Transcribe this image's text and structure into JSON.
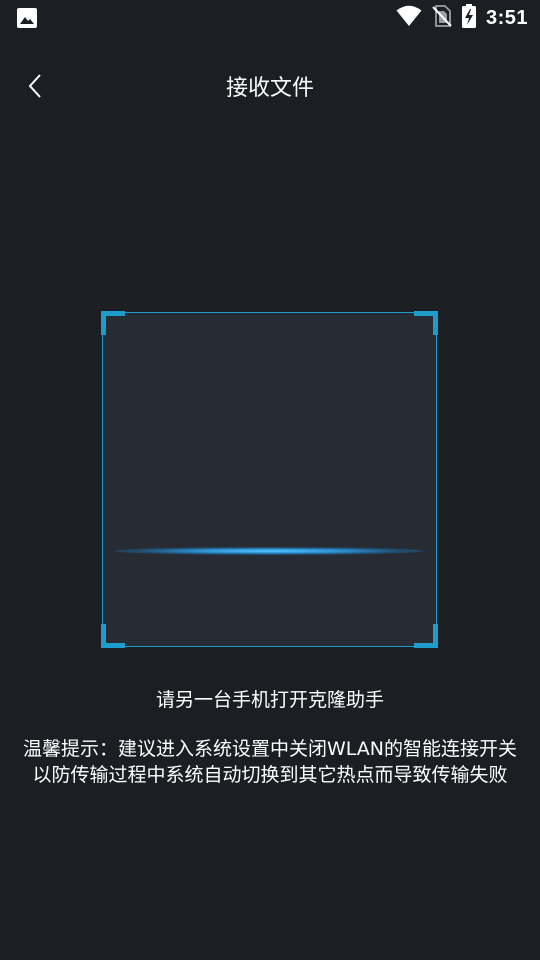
{
  "status_bar": {
    "time": "3:51",
    "icons": [
      "gallery-notification-icon",
      "wifi-icon",
      "no-sim-icon",
      "battery-charging-icon"
    ]
  },
  "header": {
    "title": "接收文件",
    "back_icon": "chevron-left-icon"
  },
  "scanner": {
    "accent_color": "#1e9ccc",
    "state": "scanning"
  },
  "hint": {
    "main": "请另一台手机打开克隆助手",
    "tip_line1": "温馨提示：建议进入系统设置中关闭WLAN的智能连接开关",
    "tip_line2": "以防传输过程中系统自动切换到其它热点而导致传输失败"
  },
  "colors": {
    "background": "#1b1f24",
    "scan_area": "#262b34",
    "accent": "#1e9ccc"
  }
}
